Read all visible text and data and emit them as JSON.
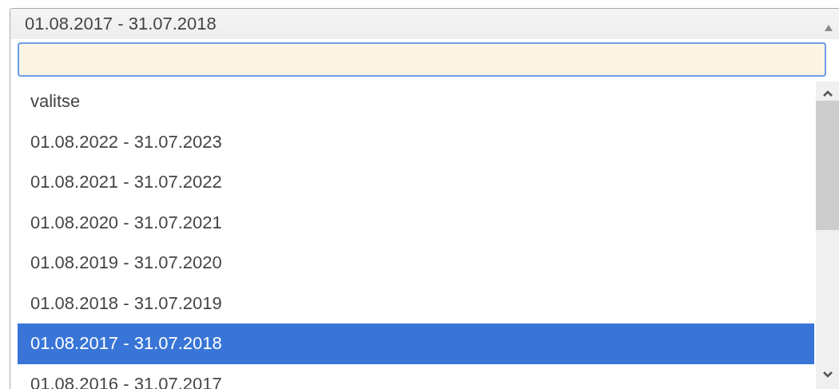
{
  "select": {
    "value": "01.08.2017 - 31.07.2018",
    "expanded": true
  },
  "options": [
    {
      "label": "valitse",
      "selected": false
    },
    {
      "label": "01.08.2022 - 31.07.2023",
      "selected": false
    },
    {
      "label": "01.08.2021 - 31.07.2022",
      "selected": false
    },
    {
      "label": "01.08.2020 - 31.07.2021",
      "selected": false
    },
    {
      "label": "01.08.2019 - 31.07.2020",
      "selected": false
    },
    {
      "label": "01.08.2018 - 31.07.2019",
      "selected": false
    },
    {
      "label": "01.08.2017 - 31.07.2018",
      "selected": true
    },
    {
      "label": "01.08.2016 - 31.07.2017",
      "selected": false
    }
  ]
}
